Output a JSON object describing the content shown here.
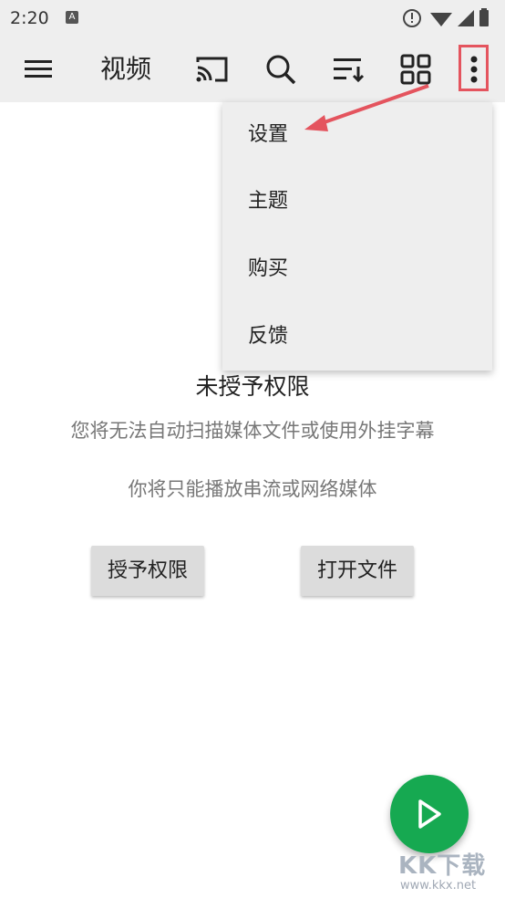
{
  "status_bar": {
    "time": "2:20",
    "notification_letter": "A"
  },
  "toolbar": {
    "title": "视频"
  },
  "menu": {
    "items": [
      "设置",
      "主题",
      "购买",
      "反馈"
    ]
  },
  "empty_state": {
    "title": "未授予权限",
    "subtitle": "您将无法自动扫描媒体文件或使用外挂字幕",
    "subtitle2": "你将只能播放串流或网络媒体",
    "grant_button": "授予权限",
    "open_file_button": "打开文件"
  },
  "watermark": {
    "main": "KK下载",
    "url": "www.kkx.net"
  },
  "colors": {
    "accent": "#16a951",
    "highlight": "#e4545e"
  }
}
